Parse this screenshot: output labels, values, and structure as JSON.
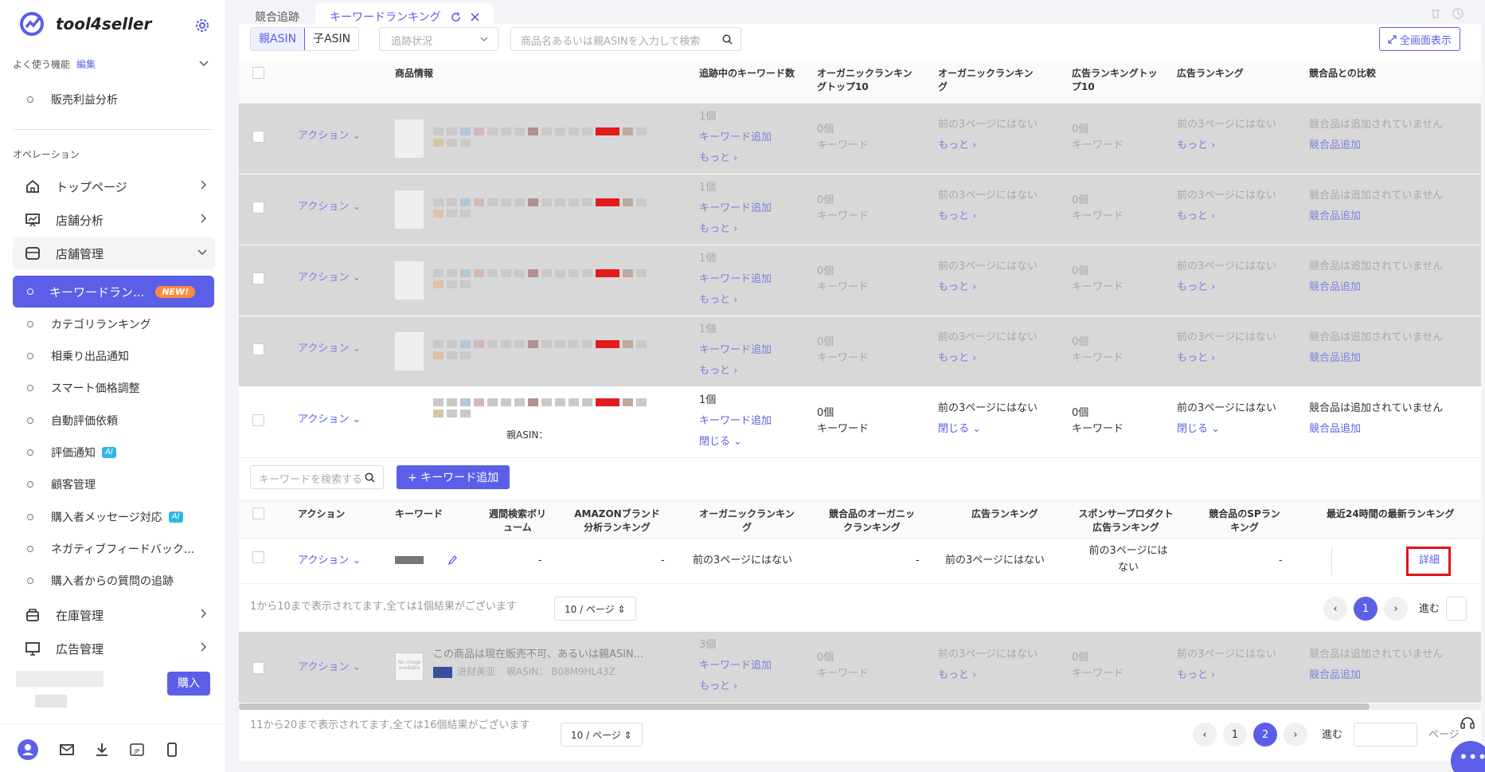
{
  "app": {
    "name": "tool4seller"
  },
  "sidebar": {
    "favorites_label": "よく使う機能",
    "edit_label": "編集",
    "favorite_item": "販売利益分析",
    "operations_label": "オペレーション",
    "menu": [
      {
        "label": "トップページ"
      },
      {
        "label": "店舗分析"
      },
      {
        "label": "店舗管理"
      }
    ],
    "active_item": "キーワードラン...",
    "new_badge": "NEW!",
    "subitems": [
      {
        "label": "カテゴリランキング",
        "ai": ""
      },
      {
        "label": "相乗り出品通知",
        "ai": ""
      },
      {
        "label": "スマート価格調整",
        "ai": ""
      },
      {
        "label": "自動評価依頼",
        "ai": ""
      },
      {
        "label": "評価通知",
        "ai": "AI"
      },
      {
        "label": "顧客管理",
        "ai": ""
      },
      {
        "label": "購入者メッセージ対応",
        "ai": "AI"
      },
      {
        "label": "ネガティブフィードバック...",
        "ai": ""
      },
      {
        "label": "購入者からの質問の追跡",
        "ai": ""
      }
    ],
    "menu2": [
      {
        "label": "在庫管理"
      },
      {
        "label": "広告管理"
      }
    ],
    "buy_label": "購入"
  },
  "tabs": [
    {
      "label": "競合追跡"
    },
    {
      "label": "キーワードランキング"
    }
  ],
  "filters": {
    "parent_asin": "親ASIN",
    "child_asin": "子ASIN",
    "status_placeholder": "追跡状況",
    "search_placeholder": "商品名あるいは親ASINを入力して検索",
    "fullscreen": "全画面表示"
  },
  "table": {
    "headers": [
      "商品情報",
      "追跡中のキーワード数",
      "オーガニックランキングトップ10",
      "オーガニックランキング",
      "広告ランキングトップ10",
      "広告ランキング",
      "競合品との比較"
    ],
    "action": "アクション",
    "count1": "1個",
    "count3": "3個",
    "add_keyword": "キーワード追加",
    "more": "もっと",
    "close": "閉じる",
    "zero": "0個",
    "keyword": "キーワード",
    "not_top3": "前の3ページにはない",
    "no_competitor": "競合品は追加されていません",
    "add_competitor": "競合品追加",
    "parent_asin_label": "親ASIN：",
    "last_title": "この商品は現在販売不可、あるいは親ASIN...",
    "last_shop": "进财美亚",
    "last_asin": "親ASIN： B08M9HL43Z",
    "no_image": "No image available"
  },
  "subtable": {
    "search_placeholder": "キーワードを検索する",
    "add_button": "+ キーワード追加",
    "headers": [
      "アクション",
      "キーワード",
      "週間検索ボリューム",
      "AMAZONブランド分析ランキング",
      "オーガニックランキング",
      "競合品のオーガニックランキング",
      "広告ランキング",
      "スポンサープロダクト広告ランキング",
      "競合品のSPランキング",
      "最近24時間の最新ランキング"
    ],
    "row": {
      "action": "アクション",
      "vol": "-",
      "brand": "-",
      "organic": "前の3ページにはない",
      "comp_org": "-",
      "ad": "前の3ページにはない",
      "sp": "前の3ページにはない",
      "comp_sp": "-",
      "detail": "詳細"
    },
    "pager_text": "1から10まで表示されてます,全ては1個結果がございます",
    "page_size": "10 / ページ",
    "page": "1",
    "go": "進む"
  },
  "footer": {
    "pager_text": "11から20まで表示されてます,全ては16個結果がございます",
    "page_size": "10 / ページ",
    "pages": [
      "1",
      "2"
    ],
    "go": "進む",
    "page_unit": "ページ"
  },
  "colors": {
    "accent": "#5b5fe8",
    "highlight": "#e0151a"
  }
}
